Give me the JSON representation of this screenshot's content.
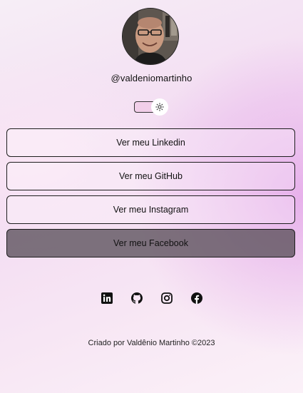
{
  "profile": {
    "username": "@valdeniomartinho"
  },
  "theme_toggle": {
    "icon": "sun-icon"
  },
  "links": [
    {
      "label": "Ver meu Linkedin"
    },
    {
      "label": "Ver meu GitHub"
    },
    {
      "label": "Ver meu Instagram"
    },
    {
      "label": "Ver meu Facebook"
    }
  ],
  "social_icons": [
    "linkedin-icon",
    "github-icon",
    "instagram-icon",
    "facebook-icon"
  ],
  "footer": {
    "text": "Criado por Valdênio Martinho ©2023"
  },
  "colors": {
    "background_accent": "#e2a0e8",
    "active_button": "#5a505a"
  }
}
